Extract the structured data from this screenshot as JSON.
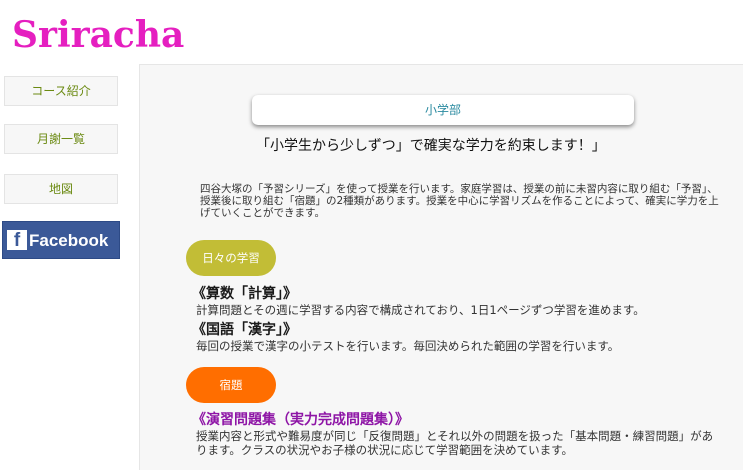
{
  "brand": {
    "logo_text": "Sriracha"
  },
  "sidebar": {
    "items": [
      {
        "label": "コース紹介"
      },
      {
        "label": "月謝一覧"
      },
      {
        "label": "地図"
      }
    ],
    "facebook_label": "Facebook"
  },
  "main": {
    "section_title": "小学部",
    "headline": "「小学生から少しずつ」で確実な学力を約束します！」",
    "intro": "四谷大塚の「予習シリーズ」を使って授業を行います。家庭学習は、授業の前に未習内容に取り組む「予習」、授業後に取り組む「宿題」の2種類があります。授業を中心に学習リズムを作ることによって、確実に学力を上げていくことができます。",
    "daily": {
      "pill": "日々の学習",
      "math_title": "《算数「計算」》",
      "math_text": "計算問題とその週に学習する内容で構成されており、1日1ページずつ学習を進めます。",
      "japanese_title": "《国語「漢字」》",
      "japanese_text": "毎回の授業で漢字の小テストを行います。毎回決められた範囲の学習を行います。"
    },
    "homework": {
      "pill": "宿題",
      "title": "《演習問題集（実力完成問題集）》",
      "text": "授業内容と形式や難易度が同じ「反復問題」とそれ以外の問題を扱った「基本問題・練習問題」があります。クラスの状況やお子様の状況に応じて学習範囲を決めています。"
    }
  },
  "colors": {
    "logo": "#e51fc0",
    "nav_text": "#6b8a12",
    "facebook": "#3b5998",
    "pill_olive": "#c2bd36",
    "pill_orange": "#ff6e00",
    "purple_heading": "#8e15a6"
  }
}
